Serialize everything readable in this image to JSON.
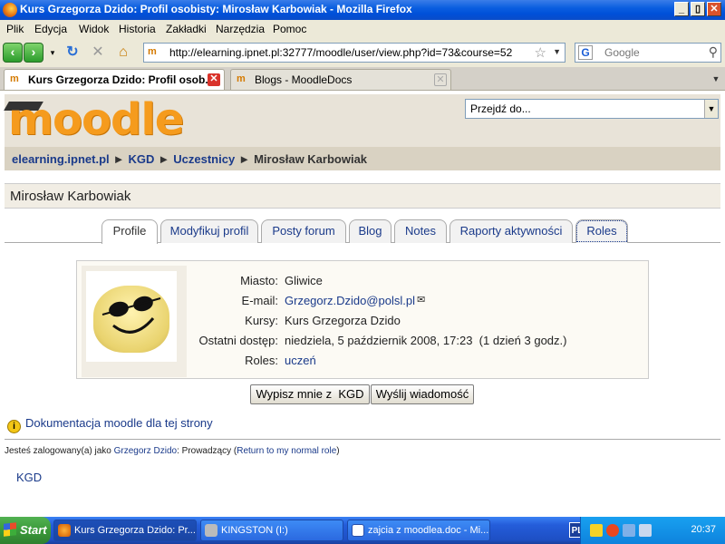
{
  "window": {
    "title": "Kurs Grzegorza Dzido: Profil osobisty: Mirosław Karbowiak - Mozilla Firefox",
    "min": "_",
    "max": "▯",
    "close": "✕"
  },
  "menu": [
    "Plik",
    "Edycja",
    "Widok",
    "Historia",
    "Zakładki",
    "Narzędzia",
    "Pomoc"
  ],
  "url": "http://elearning.ipnet.pl:32777/moodle/user/view.php?id=73&course=52",
  "search": {
    "placeholder": "Google"
  },
  "browser_tabs": [
    {
      "label": "Kurs Grzegorza Dzido: Profil osob..."
    },
    {
      "label": "Blogs - MoodleDocs"
    }
  ],
  "site": {
    "logo": "moodle",
    "jump_to": "Przejdź do...",
    "breadcrumb": [
      "elearning.ipnet.pl",
      "KGD",
      "Uczestnicy",
      "Mirosław Karbowiak"
    ],
    "breadcrumb_sep": "►",
    "page_title": "Mirosław Karbowiak"
  },
  "profile_tabs": [
    "Profile",
    "Modyfikuj profil",
    "Posty forum",
    "Blog",
    "Notes",
    "Raporty aktywności",
    "Roles"
  ],
  "profile": {
    "fields": [
      {
        "label": "Miasto:",
        "value": "Gliwice"
      },
      {
        "label": "E-mail:",
        "value": "Grzegorz.Dzido@polsl.pl"
      },
      {
        "label": "Kursy:",
        "value": "Kurs Grzegorza Dzido"
      },
      {
        "label": "Ostatni dostęp:",
        "value": "niedziela, 5 październik 2008, 17:23  (1 dzień 3 godz.)"
      },
      {
        "label": "Roles:",
        "value": "uczeń"
      }
    ]
  },
  "buttons": {
    "unenrol": "Wypisz mnie z  KGD",
    "message": "Wyślij wiadomość"
  },
  "footer": {
    "docs": "Dokumentacja moodle dla tej strony",
    "logged_prefix": "Jesteś zalogowany(a) jako",
    "user": "Grzegorz Dzido",
    "role_text": ": Prowadzący (",
    "return_link": "Return to my normal role",
    "close_paren": ")",
    "course_link": "KGD"
  },
  "taskbar": {
    "start": "Start",
    "items": [
      "Kurs Grzegorza Dzido: Pr...",
      "KINGSTON (I:)",
      "zajcia z moodlea.doc - Mi..."
    ],
    "lang": "PL",
    "clock": "20:37"
  },
  "colors": {
    "link": "#1a3a8a",
    "moodle_orange": "#f59b1d",
    "xp_blue": "#0a5ee0"
  }
}
